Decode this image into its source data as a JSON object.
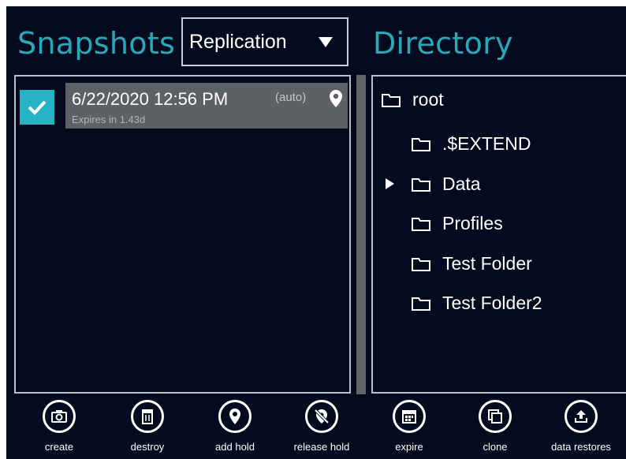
{
  "snapshots": {
    "title": "Snapshots",
    "filter": {
      "selected": "Replication"
    },
    "items": [
      {
        "date": "6/22/2020 12:56 PM",
        "expires": "Expires in 1.43d",
        "tag": "(auto)",
        "checked": true,
        "hold_icon": "location-pin-icon"
      }
    ]
  },
  "directory": {
    "title": "Directory",
    "tree": [
      {
        "label": "root",
        "icon": "folder-icon",
        "level": 0
      },
      {
        "label": ".$EXTEND",
        "icon": "folder-icon",
        "level": 1
      },
      {
        "label": "Data",
        "icon": "folder-icon",
        "level": 1,
        "expandable": true
      },
      {
        "label": "Profiles",
        "icon": "folder-icon",
        "level": 1
      },
      {
        "label": "Test Folder",
        "icon": "folder-icon",
        "level": 1
      },
      {
        "label": "Test Folder2",
        "icon": "folder-icon",
        "level": 1
      }
    ]
  },
  "toolbar": {
    "buttons": [
      {
        "label": "create",
        "icon": "camera-icon"
      },
      {
        "label": "destroy",
        "icon": "trash-icon"
      },
      {
        "label": "add hold",
        "icon": "location-pin-icon"
      },
      {
        "label": "release hold",
        "icon": "pin-slash-icon"
      },
      {
        "label": "expire",
        "icon": "calendar-icon"
      },
      {
        "label": "clone",
        "icon": "clone-icon"
      },
      {
        "label": "data restores",
        "icon": "upload-icon"
      }
    ]
  },
  "colors": {
    "accent": "#2aa8b8",
    "background": "#050b1f",
    "checkbox": "#26b3c4",
    "selected_row": "#5d6166"
  }
}
